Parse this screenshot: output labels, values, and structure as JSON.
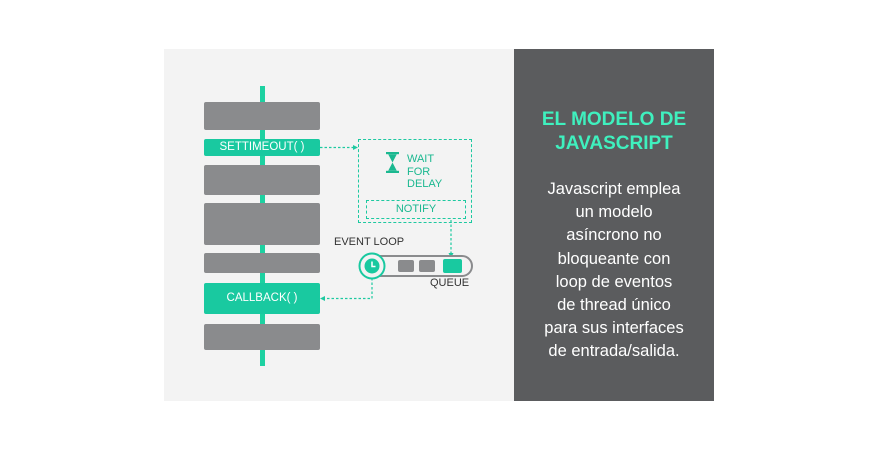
{
  "diagram": {
    "settimeout_label": "SETTIMEOUT( )",
    "callback_label": "CALLBACK( )",
    "wait_lines": [
      "WAIT",
      "FOR",
      "DELAY"
    ],
    "notify_label": "NOTIFY",
    "event_loop_label": "EVENT LOOP",
    "queue_label": "QUEUE",
    "icons": [
      "hourglass-icon",
      "clock-icon"
    ],
    "colors": {
      "accent": "#1dd1a1",
      "block": "#8a8b8d",
      "panel": "#5b5c5e"
    }
  },
  "sidebar": {
    "title_line1": "EL MODELO DE",
    "title_line2": "JAVASCRIPT",
    "description_lines": [
      "Javascript emplea",
      "un modelo",
      "asíncrono no",
      "bloqueante con",
      "loop de eventos",
      "de thread único",
      "para sus interfaces",
      "de entrada/salida."
    ]
  }
}
